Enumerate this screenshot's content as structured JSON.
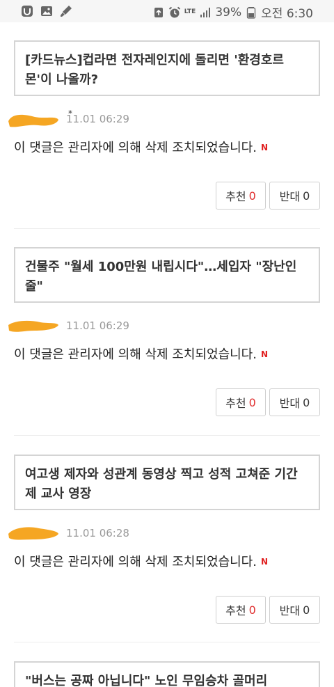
{
  "status_bar": {
    "network": "LTE",
    "battery": "39%",
    "time": "오전 6:30"
  },
  "comments": [
    {
      "article_title": "[카드뉴스]컵라면 전자레인지에 돌리면 '환경호르몬'이 나올까?",
      "date": "11.01 06:29",
      "text": "이 댓글은 관리자에 의해 삭제 조치되었습니다.",
      "badge": "N",
      "recommend_label": "추천",
      "recommend_count": "0",
      "oppose_label": "반대",
      "oppose_count": "0"
    },
    {
      "article_title": "건물주 \"월세 100만원 내립시다\"…세입자 \"장난인줄\"",
      "date": "11.01 06:29",
      "text": "이 댓글은 관리자에 의해 삭제 조치되었습니다.",
      "badge": "N",
      "recommend_label": "추천",
      "recommend_count": "0",
      "oppose_label": "반대",
      "oppose_count": "0"
    },
    {
      "article_title": "여고생 제자와 성관계 동영상 찍고 성적 고쳐준 기간제 교사 영장",
      "date": "11.01 06:28",
      "text": "이 댓글은 관리자에 의해 삭제 조치되었습니다.",
      "badge": "N",
      "recommend_label": "추천",
      "recommend_count": "0",
      "oppose_label": "반대",
      "oppose_count": "0"
    }
  ],
  "partial_article_title": "\"버스는 공짜 아닙니다\" 노인 무임승차 골머리"
}
